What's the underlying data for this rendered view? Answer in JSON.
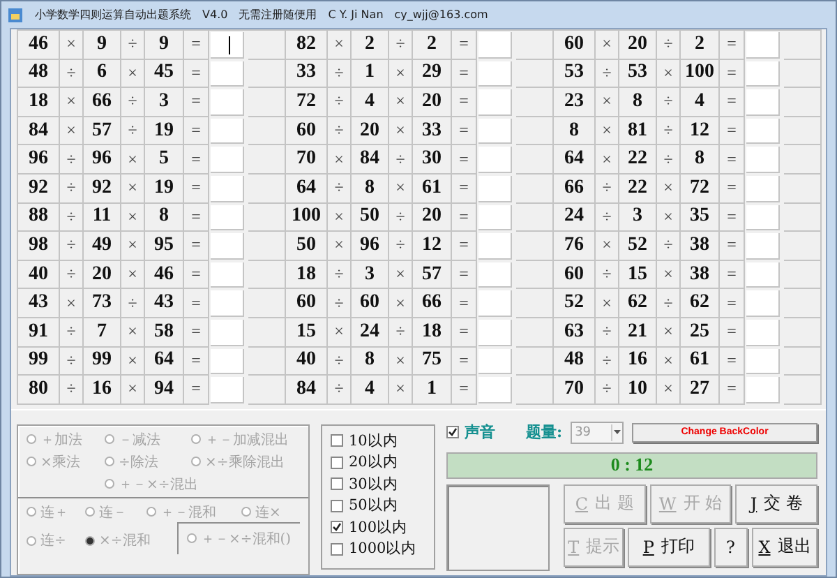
{
  "window": {
    "title_parts": [
      "小学数学四则运算自动出题系统",
      "V4.0",
      "无需注册随便用",
      "C Y. Ji Nan",
      "cy_wjj@163.com"
    ]
  },
  "problem_groups": [
    [
      {
        "a": "46",
        "op1": "×",
        "b": "9",
        "op2": "÷",
        "c": "9",
        "eq": "=",
        "focused": true
      },
      {
        "a": "48",
        "op1": "÷",
        "b": "6",
        "op2": "×",
        "c": "45",
        "eq": "=",
        "focused": false
      },
      {
        "a": "18",
        "op1": "×",
        "b": "66",
        "op2": "÷",
        "c": "3",
        "eq": "=",
        "focused": false
      },
      {
        "a": "84",
        "op1": "×",
        "b": "57",
        "op2": "÷",
        "c": "19",
        "eq": "=",
        "focused": false
      },
      {
        "a": "96",
        "op1": "÷",
        "b": "96",
        "op2": "×",
        "c": "5",
        "eq": "=",
        "focused": false
      },
      {
        "a": "92",
        "op1": "÷",
        "b": "92",
        "op2": "×",
        "c": "19",
        "eq": "=",
        "focused": false
      },
      {
        "a": "88",
        "op1": "÷",
        "b": "11",
        "op2": "×",
        "c": "8",
        "eq": "=",
        "focused": false
      },
      {
        "a": "98",
        "op1": "÷",
        "b": "49",
        "op2": "×",
        "c": "95",
        "eq": "=",
        "focused": false
      },
      {
        "a": "40",
        "op1": "÷",
        "b": "20",
        "op2": "×",
        "c": "46",
        "eq": "=",
        "focused": false
      },
      {
        "a": "43",
        "op1": "×",
        "b": "73",
        "op2": "÷",
        "c": "43",
        "eq": "=",
        "focused": false
      },
      {
        "a": "91",
        "op1": "÷",
        "b": "7",
        "op2": "×",
        "c": "58",
        "eq": "=",
        "focused": false
      },
      {
        "a": "99",
        "op1": "÷",
        "b": "99",
        "op2": "×",
        "c": "64",
        "eq": "=",
        "focused": false
      },
      {
        "a": "80",
        "op1": "÷",
        "b": "16",
        "op2": "×",
        "c": "94",
        "eq": "=",
        "focused": false
      }
    ],
    [
      {
        "a": "82",
        "op1": "×",
        "b": "2",
        "op2": "÷",
        "c": "2",
        "eq": "=",
        "focused": false
      },
      {
        "a": "33",
        "op1": "÷",
        "b": "1",
        "op2": "×",
        "c": "29",
        "eq": "=",
        "focused": false
      },
      {
        "a": "72",
        "op1": "÷",
        "b": "4",
        "op2": "×",
        "c": "20",
        "eq": "=",
        "focused": false
      },
      {
        "a": "60",
        "op1": "÷",
        "b": "20",
        "op2": "×",
        "c": "33",
        "eq": "=",
        "focused": false
      },
      {
        "a": "70",
        "op1": "×",
        "b": "84",
        "op2": "÷",
        "c": "30",
        "eq": "=",
        "focused": false
      },
      {
        "a": "64",
        "op1": "÷",
        "b": "8",
        "op2": "×",
        "c": "61",
        "eq": "=",
        "focused": false
      },
      {
        "a": "100",
        "op1": "×",
        "b": "50",
        "op2": "÷",
        "c": "20",
        "eq": "=",
        "focused": false
      },
      {
        "a": "50",
        "op1": "×",
        "b": "96",
        "op2": "÷",
        "c": "12",
        "eq": "=",
        "focused": false
      },
      {
        "a": "18",
        "op1": "÷",
        "b": "3",
        "op2": "×",
        "c": "57",
        "eq": "=",
        "focused": false
      },
      {
        "a": "60",
        "op1": "÷",
        "b": "60",
        "op2": "×",
        "c": "66",
        "eq": "=",
        "focused": false
      },
      {
        "a": "15",
        "op1": "×",
        "b": "24",
        "op2": "÷",
        "c": "18",
        "eq": "=",
        "focused": false
      },
      {
        "a": "40",
        "op1": "÷",
        "b": "8",
        "op2": "×",
        "c": "75",
        "eq": "=",
        "focused": false
      },
      {
        "a": "84",
        "op1": "÷",
        "b": "4",
        "op2": "×",
        "c": "1",
        "eq": "=",
        "focused": false
      }
    ],
    [
      {
        "a": "60",
        "op1": "×",
        "b": "20",
        "op2": "÷",
        "c": "2",
        "eq": "=",
        "focused": false
      },
      {
        "a": "53",
        "op1": "÷",
        "b": "53",
        "op2": "×",
        "c": "100",
        "eq": "=",
        "focused": false
      },
      {
        "a": "23",
        "op1": "×",
        "b": "8",
        "op2": "÷",
        "c": "4",
        "eq": "=",
        "focused": false
      },
      {
        "a": "8",
        "op1": "×",
        "b": "81",
        "op2": "÷",
        "c": "12",
        "eq": "=",
        "focused": false
      },
      {
        "a": "64",
        "op1": "×",
        "b": "22",
        "op2": "÷",
        "c": "8",
        "eq": "=",
        "focused": false
      },
      {
        "a": "66",
        "op1": "÷",
        "b": "22",
        "op2": "×",
        "c": "72",
        "eq": "=",
        "focused": false
      },
      {
        "a": "24",
        "op1": "÷",
        "b": "3",
        "op2": "×",
        "c": "35",
        "eq": "=",
        "focused": false
      },
      {
        "a": "76",
        "op1": "×",
        "b": "52",
        "op2": "÷",
        "c": "38",
        "eq": "=",
        "focused": false
      },
      {
        "a": "60",
        "op1": "÷",
        "b": "15",
        "op2": "×",
        "c": "38",
        "eq": "=",
        "focused": false
      },
      {
        "a": "52",
        "op1": "×",
        "b": "62",
        "op2": "÷",
        "c": "62",
        "eq": "=",
        "focused": false
      },
      {
        "a": "63",
        "op1": "÷",
        "b": "21",
        "op2": "×",
        "c": "25",
        "eq": "=",
        "focused": false
      },
      {
        "a": "48",
        "op1": "÷",
        "b": "16",
        "op2": "×",
        "c": "61",
        "eq": "=",
        "focused": false
      },
      {
        "a": "70",
        "op1": "÷",
        "b": "10",
        "op2": "×",
        "c": "27",
        "eq": "=",
        "focused": false
      }
    ]
  ],
  "operation_modes": [
    {
      "label": "＋加法",
      "selected": false
    },
    {
      "label": "－减法",
      "selected": false
    },
    {
      "label": "＋－加减混出",
      "selected": false
    },
    {
      "label": "×乘法",
      "selected": false
    },
    {
      "label": "÷除法",
      "selected": false
    },
    {
      "label": "×÷乘除混出",
      "selected": false
    },
    {
      "label": "＋－×÷混出",
      "selected": false
    }
  ],
  "chain_modes": [
    {
      "label": "连＋",
      "selected": false,
      "kind": "plain"
    },
    {
      "label": "连－",
      "selected": false,
      "kind": "plain"
    },
    {
      "label": "＋－混和",
      "selected": false,
      "kind": "plain"
    },
    {
      "label": "连×",
      "selected": false,
      "kind": "plain"
    },
    {
      "label": "连÷",
      "selected": false,
      "kind": "plain"
    },
    {
      "label": "×÷混和",
      "selected": true,
      "kind": "plain"
    },
    {
      "label": "＋－×÷混和()",
      "selected": false,
      "kind": "boxed"
    }
  ],
  "ranges": [
    {
      "label": "10以内",
      "checked": false
    },
    {
      "label": "20以内",
      "checked": false
    },
    {
      "label": "30以内",
      "checked": false
    },
    {
      "label": "50以内",
      "checked": false
    },
    {
      "label": "100以内",
      "checked": true
    },
    {
      "label": "1000以内",
      "checked": false
    }
  ],
  "sound": {
    "label": "声音",
    "checked": true
  },
  "count": {
    "label": "题量:",
    "value": "39"
  },
  "color_button": "Change BackColor",
  "timer": "0 : 12",
  "buttons": [
    [
      {
        "key": "C",
        "label": "出 题",
        "disabled": true
      },
      {
        "key": "W",
        "label": "开 始",
        "disabled": true
      },
      {
        "key": "J",
        "label": "交 卷",
        "disabled": false
      }
    ],
    [
      {
        "key": "T",
        "label": "提示",
        "disabled": true
      },
      {
        "key": "P",
        "label": "打印",
        "disabled": false
      },
      {
        "label": "?",
        "disabled": false
      },
      {
        "key": "X",
        "label": "退出",
        "disabled": false
      }
    ]
  ]
}
